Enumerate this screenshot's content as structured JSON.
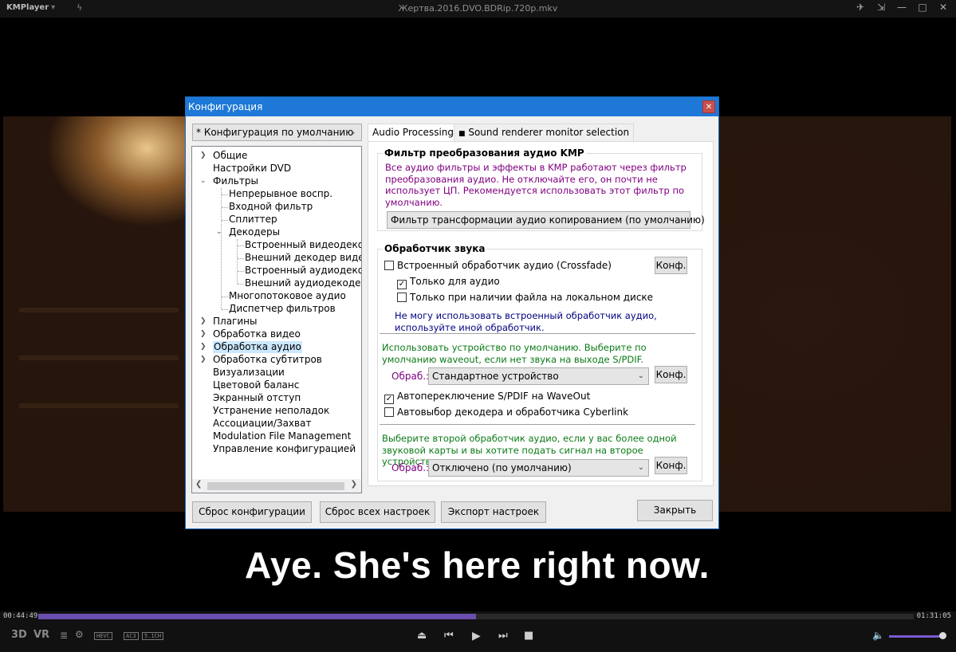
{
  "player": {
    "brand": "KMPlayer",
    "brand_dropdown": "▾",
    "file_title": "Жертва.2016.DVO.BDRip.720p.mkv",
    "subtitle": "Aye. She's here right now.",
    "time_current": "00:44:49",
    "time_total": "01:31:05",
    "progress_fraction": 0.5,
    "badges": [
      "HEVC",
      "AC3",
      "5.1CH"
    ],
    "volume_fraction": 0.95,
    "labels3d": "3D",
    "labelvr": "VR"
  },
  "dialog": {
    "title": "Конфигурация",
    "preset": "* Конфигурация по умолчанию",
    "tree": [
      {
        "label": "Общие",
        "level": 0,
        "expander": "right"
      },
      {
        "label": "Настройки DVD",
        "level": 0,
        "expander": ""
      },
      {
        "label": "Фильтры",
        "level": 0,
        "expander": "down"
      },
      {
        "label": "Непрерывное воспр.",
        "level": 1,
        "expander": ""
      },
      {
        "label": "Входной фильтр",
        "level": 1,
        "expander": ""
      },
      {
        "label": "Сплиттер",
        "level": 1,
        "expander": ""
      },
      {
        "label": "Декодеры",
        "level": 1,
        "expander": "down"
      },
      {
        "label": "Встроенный видеодекоде",
        "level": 2,
        "expander": ""
      },
      {
        "label": "Внешний декодер видео",
        "level": 2,
        "expander": ""
      },
      {
        "label": "Встроенный аудиодекоде",
        "level": 2,
        "expander": ""
      },
      {
        "label": "Внешний аудиодекодер",
        "level": 2,
        "expander": ""
      },
      {
        "label": "Многопотоковое аудио",
        "level": 1,
        "expander": ""
      },
      {
        "label": "Диспетчер фильтров",
        "level": 1,
        "expander": ""
      },
      {
        "label": "Плагины",
        "level": 0,
        "expander": "right"
      },
      {
        "label": "Обработка видео",
        "level": 0,
        "expander": "right"
      },
      {
        "label": "Обработка аудио",
        "level": 0,
        "expander": "right",
        "selected": true
      },
      {
        "label": "Обработка субтитров",
        "level": 0,
        "expander": "right"
      },
      {
        "label": "Визуализации",
        "level": 0,
        "expander": ""
      },
      {
        "label": "Цветовой баланс",
        "level": 0,
        "expander": ""
      },
      {
        "label": "Экранный отступ",
        "level": 0,
        "expander": ""
      },
      {
        "label": "Устранение неполадок",
        "level": 0,
        "expander": ""
      },
      {
        "label": "Ассоциации/Захват",
        "level": 0,
        "expander": ""
      },
      {
        "label": "Modulation File Management",
        "level": 0,
        "expander": ""
      },
      {
        "label": "Управление конфигурацией",
        "level": 0,
        "expander": ""
      }
    ],
    "tabs": {
      "active": "Audio Processing",
      "second": "Sound renderer monitor selection",
      "second_icon": "■"
    },
    "group1": {
      "title": "Фильтр преобразования аудио KMP",
      "desc": "Все аудио фильтры и эффекты в KMP работают через фильтр преобразования аудио. Не отключайте его, он почти не использует ЦП. Рекомендуется использовать этот фильтр по умолчанию.",
      "combo": "Фильтр трансформации аудио копированием (по умолчанию)"
    },
    "group2": {
      "title": "Обработчик звука",
      "cb_crossfade": "Встроенный обработчик аудио (Crossfade)",
      "cb_crossfade_checked": false,
      "cb_audio_only": "Только для аудио",
      "cb_audio_only_checked": true,
      "cb_local": "Только при наличии файла на локальном диске",
      "cb_local_checked": false,
      "cannot_use": "Не могу использовать встроенный обработчик аудио, используйте иной обработчик.",
      "device_note": "Использовать устройство по умолчанию. Выберите по умолчанию waveout, если нет звука на выходе S/PDIF.",
      "obr_label": "Обраб.:",
      "device_combo": "Стандартное устройство",
      "cb_spdif": "Автопереключение S/PDIF на WaveOut",
      "cb_spdif_checked": true,
      "cb_cyberlink": "Автовыбор декодера и обработчика Cyberlink",
      "cb_cyberlink_checked": false,
      "second_note": "Выберите второй обработчик аудио, если у вас более одной звуковой карты и вы хотите подать сигнал на второе устройство.",
      "second_combo": "Отключено (по умолчанию)",
      "conf": "Конф."
    },
    "buttons": {
      "reset_config": "Сброс конфигурации",
      "reset_all": "Сброс всех настроек",
      "export": "Экспорт настроек",
      "close": "Закрыть"
    }
  }
}
